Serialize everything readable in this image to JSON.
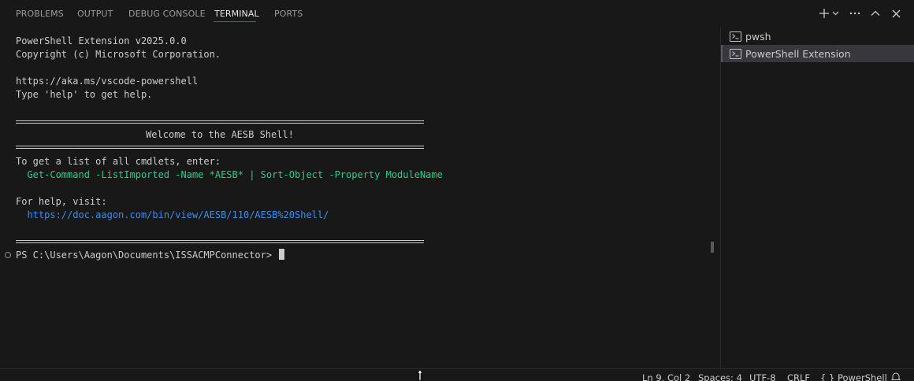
{
  "tabs": [
    {
      "label": "PROBLEMS"
    },
    {
      "label": "OUTPUT"
    },
    {
      "label": "DEBUG CONSOLE"
    },
    {
      "label": "TERMINAL"
    },
    {
      "label": "PORTS"
    }
  ],
  "active_tab": "TERMINAL",
  "actions": {
    "new_terminal_icon": "plus-icon",
    "dropdown_icon": "chevron-down-icon",
    "more_icon": "ellipsis-icon",
    "maximize_icon": "chevron-up-icon",
    "close_icon": "close-icon"
  },
  "terminal": {
    "line1": "PowerShell Extension v2025.0.0",
    "line2": "Copyright (c) Microsoft Corporation.",
    "line3": "https://aka.ms/vscode-powershell",
    "line4": "Type 'help' to get help.",
    "welcome": "Welcome to the AESB Shell!",
    "cmdlets_intro": "To get a list of all cmdlets, enter:",
    "cmdlets_command": "  Get-Command -ListImported -Name *AESB* | Sort-Object -Property ModuleName",
    "help_intro": "For help, visit:",
    "help_url": "  https://doc.aagon.com/bin/view/AESB/110/AESB%20Shell/",
    "prompt": "PS C:\\Users\\Aagon\\Documents\\ISSACMPConnector> "
  },
  "terminal_list": [
    {
      "name": "pwsh",
      "selected": false
    },
    {
      "name": "PowerShell Extension",
      "selected": true
    }
  ],
  "statusbar": {
    "position": "Ln 9, Col 2",
    "spaces": "Spaces: 4",
    "encoding": "UTF-8",
    "eol": "CRLF",
    "language_braces": "{ }",
    "language": "PowerShell"
  },
  "colors": {
    "background": "#181818",
    "command_green": "#23d18b",
    "link_blue": "#3b8eea",
    "accent": "#0078d4"
  }
}
